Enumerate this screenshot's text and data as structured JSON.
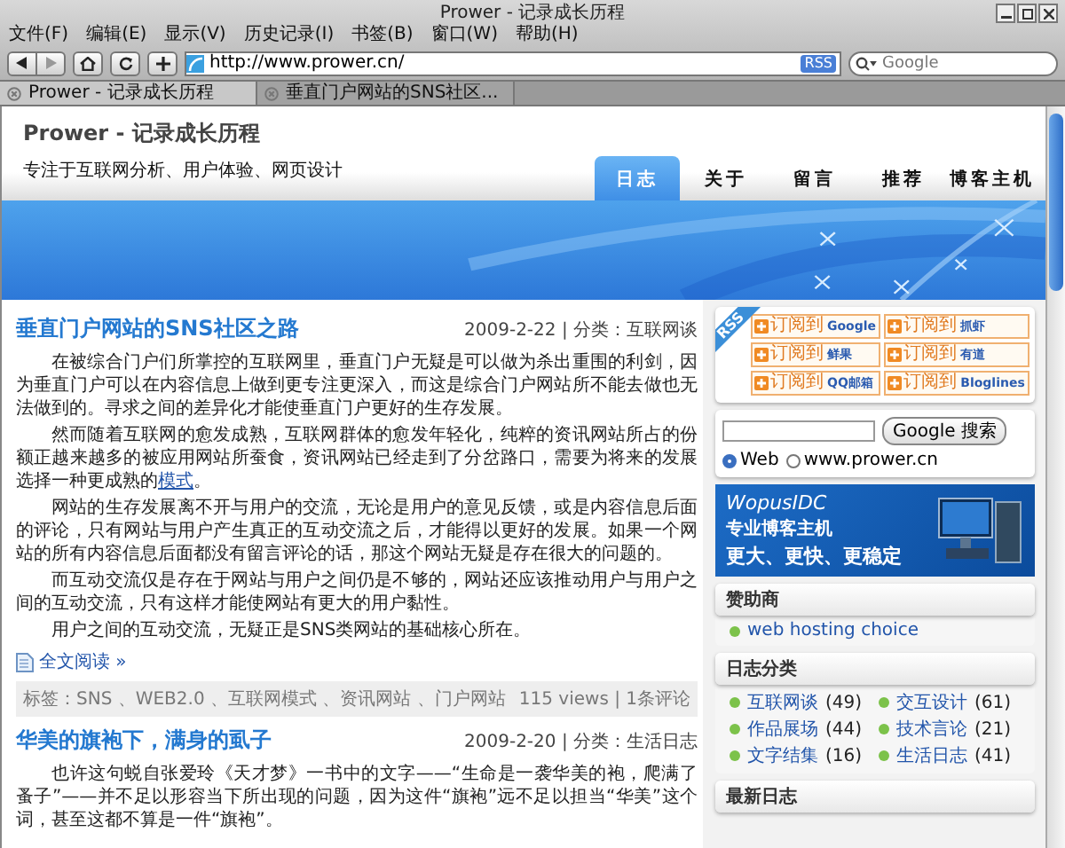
{
  "window": {
    "title": "Prower - 记录成长历程"
  },
  "menu": [
    "文件(F)",
    "编辑(E)",
    "显示(V)",
    "历史记录(I)",
    "书签(B)",
    "窗口(W)",
    "帮助(H)"
  ],
  "address": {
    "value": "http://www.prower.cn/",
    "badge": "RSS"
  },
  "search": {
    "placeholder": "Google"
  },
  "tabs": [
    {
      "label": "Prower - 记录成长历程",
      "selected": true
    },
    {
      "label": "垂直门户网站的SNS社区...",
      "selected": false
    }
  ],
  "site": {
    "title": "Prower - 记录成长历程",
    "tagline": "专注于互联网分析、用户体验、网页设计"
  },
  "nav": [
    {
      "label": "日志",
      "selected": true
    },
    {
      "label": "关于",
      "selected": false
    },
    {
      "label": "留言",
      "selected": false
    },
    {
      "label": "推荐",
      "selected": false
    },
    {
      "label": "博客主机",
      "selected": false
    }
  ],
  "posts": [
    {
      "title": "垂直门户网站的SNS社区之路",
      "meta": "2009-2-22 | 分类：互联网谈",
      "paragraphs": [
        {
          "text": "在被综合门户们所掌控的互联网里，垂直门户无疑是可以做为杀出重围的利剑，因为垂直门户可以在内容信息上做到更专注更深入，而这是综合门户网站所不能去做也无法做到的。寻求之间的差异化才能使垂直门户更好的生存发展。"
        },
        {
          "text": "然而随着互联网的愈发成熟，互联网群体的愈发年轻化，纯粹的资讯网站所占的份额正越来越多的被应用网站所蚕食，资讯网站已经走到了分岔路口，需要为将来的发展选择一种更成熟的",
          "link": "模式",
          "after": "。"
        },
        {
          "text": "网站的生存发展离不开与用户的交流，无论是用户的意见反馈，或是内容信息后面的评论，只有网站与用户产生真正的互动交流之后，才能得以更好的发展。如果一个网站的所有内容信息后面都没有留言评论的话，那这个网站无疑是存在很大的问题的。"
        },
        {
          "text": "而互动交流仅是存在于网站与用户之间仍是不够的，网站还应该推动用户与用户之间的互动交流，只有这样才能使网站有更大的用户黏性。"
        },
        {
          "text": "用户之间的互动交流，无疑正是SNS类网站的基础核心所在。"
        }
      ],
      "read_more": "全文阅读 »",
      "tags": "标签：SNS 、WEB2.0 、互联网模式 、资讯网站 、门户网站",
      "stats": "115 views | 1条评论"
    },
    {
      "title": "华美的旗袍下，满身的虱子",
      "meta": "2009-2-20 | 分类：生活日志",
      "paragraphs": [
        {
          "text": "也许这句蜕自张爱玲《天才梦》一书中的文字——“生命是一袭华美的袍，爬满了蚤子”——并不足以形容当下所出现的问题，因为这件“旗袍”远不足以担当“华美”这个词，甚至这都不算是一件“旗袍”。"
        }
      ]
    }
  ],
  "rss": {
    "ribbon": "RSS",
    "buttons": [
      {
        "prefix": "订阅到",
        "name": "Google"
      },
      {
        "prefix": "订阅到",
        "name": "抓虾"
      },
      {
        "prefix": "订阅到",
        "name": "鲜果"
      },
      {
        "prefix": "订阅到",
        "name": "有道"
      },
      {
        "prefix": "订阅到",
        "name": "QQ邮箱"
      },
      {
        "prefix": "订阅到",
        "name": "Bloglines"
      }
    ]
  },
  "site_search": {
    "button": "Google 搜索",
    "options": [
      {
        "label": "Web",
        "selected": true
      },
      {
        "label": "www.prower.cn",
        "selected": false
      }
    ]
  },
  "ad": {
    "brand": "WopusIDC",
    "line1": "专业博客主机",
    "line2": "更大、更快、更稳定"
  },
  "sponsors": {
    "heading": "赞助商",
    "items": [
      "web hosting choice"
    ]
  },
  "categories": {
    "heading": "日志分类",
    "items": [
      {
        "name": "互联网谈",
        "count": "(49)"
      },
      {
        "name": "交互设计",
        "count": "(61)"
      },
      {
        "name": "作品展场",
        "count": "(44)"
      },
      {
        "name": "技术言论",
        "count": "(21)"
      },
      {
        "name": "文字结集",
        "count": "(16)"
      },
      {
        "name": "生活日志",
        "count": "(41)"
      }
    ]
  },
  "latest": {
    "heading": "最新日志"
  }
}
